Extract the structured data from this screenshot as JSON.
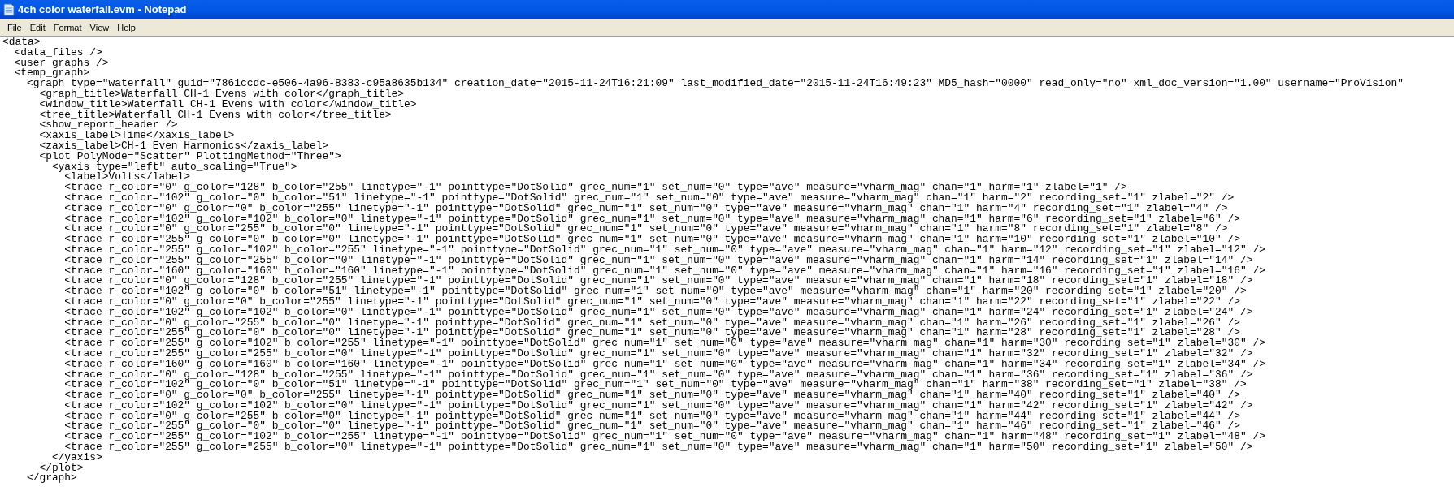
{
  "window": {
    "title": "4ch color waterfall.evm - Notepad"
  },
  "menu": [
    "File",
    "Edit",
    "Format",
    "View",
    "Help"
  ],
  "editor": {
    "lines": [
      "<data>",
      "  <data_files />",
      "  <user_graphs />",
      "  <temp_graph>",
      "    <graph type=\"waterfall\" guid=\"7861ccdc-e506-4a96-8383-c95a8635b134\" creation_date=\"2015-11-24T16:21:09\" last_modified_date=\"2015-11-24T16:49:23\" MD5_hash=\"0000\" read_only=\"no\" xml_doc_version=\"1.00\" username=\"ProVision\"",
      "      <graph_title>Waterfall CH-1 Evens with color</graph_title>",
      "      <window_title>Waterfall CH-1 Evens with color</window_title>",
      "      <tree_title>Waterfall CH-1 Evens with color</tree_title>",
      "      <show_report_header />",
      "      <xaxis_label>Time</xaxis_label>",
      "      <zaxis_label>CH-1 Even Harmonics</zaxis_label>",
      "      <plot PolyMode=\"Scatter\" PlottingMethod=\"Three\">",
      "        <yaxis type=\"left\" auto_scaling=\"True\">",
      "          <label>Volts</label>",
      "          <trace r_color=\"0\" g_color=\"128\" b_color=\"255\" linetype=\"-1\" pointtype=\"DotSolid\" grec_num=\"1\" set_num=\"0\" type=\"ave\" measure=\"vharm_mag\" chan=\"1\" harm=\"1\" zlabel=\"1\" />",
      "          <trace r_color=\"102\" g_color=\"0\" b_color=\"51\" linetype=\"-1\" pointtype=\"DotSolid\" grec_num=\"1\" set_num=\"0\" type=\"ave\" measure=\"vharm_mag\" chan=\"1\" harm=\"2\" recording_set=\"1\" zlabel=\"2\" />",
      "          <trace r_color=\"0\" g_color=\"0\" b_color=\"255\" linetype=\"-1\" pointtype=\"DotSolid\" grec_num=\"1\" set_num=\"0\" type=\"ave\" measure=\"vharm_mag\" chan=\"1\" harm=\"4\" recording_set=\"1\" zlabel=\"4\" />",
      "          <trace r_color=\"102\" g_color=\"102\" b_color=\"0\" linetype=\"-1\" pointtype=\"DotSolid\" grec_num=\"1\" set_num=\"0\" type=\"ave\" measure=\"vharm_mag\" chan=\"1\" harm=\"6\" recording_set=\"1\" zlabel=\"6\" />",
      "          <trace r_color=\"0\" g_color=\"255\" b_color=\"0\" linetype=\"-1\" pointtype=\"DotSolid\" grec_num=\"1\" set_num=\"0\" type=\"ave\" measure=\"vharm_mag\" chan=\"1\" harm=\"8\" recording_set=\"1\" zlabel=\"8\" />",
      "          <trace r_color=\"255\" g_color=\"0\" b_color=\"0\" linetype=\"-1\" pointtype=\"DotSolid\" grec_num=\"1\" set_num=\"0\" type=\"ave\" measure=\"vharm_mag\" chan=\"1\" harm=\"10\" recording_set=\"1\" zlabel=\"10\" />",
      "          <trace r_color=\"255\" g_color=\"102\" b_color=\"255\" linetype=\"-1\" pointtype=\"DotSolid\" grec_num=\"1\" set_num=\"0\" type=\"ave\" measure=\"vharm_mag\" chan=\"1\" harm=\"12\" recording_set=\"1\" zlabel=\"12\" />",
      "          <trace r_color=\"255\" g_color=\"255\" b_color=\"0\" linetype=\"-1\" pointtype=\"DotSolid\" grec_num=\"1\" set_num=\"0\" type=\"ave\" measure=\"vharm_mag\" chan=\"1\" harm=\"14\" recording_set=\"1\" zlabel=\"14\" />",
      "          <trace r_color=\"160\" g_color=\"160\" b_color=\"160\" linetype=\"-1\" pointtype=\"DotSolid\" grec_num=\"1\" set_num=\"0\" type=\"ave\" measure=\"vharm_mag\" chan=\"1\" harm=\"16\" recording_set=\"1\" zlabel=\"16\" />",
      "          <trace r_color=\"0\" g_color=\"128\" b_color=\"255\" linetype=\"-1\" pointtype=\"DotSolid\" grec_num=\"1\" set_num=\"0\" type=\"ave\" measure=\"vharm_mag\" chan=\"1\" harm=\"18\" recording_set=\"1\" zlabel=\"18\" />",
      "          <trace r_color=\"102\" g_color=\"0\" b_color=\"51\" linetype=\"-1\" pointtype=\"DotSolid\" grec_num=\"1\" set_num=\"0\" type=\"ave\" measure=\"vharm_mag\" chan=\"1\" harm=\"20\" recording_set=\"1\" zlabel=\"20\" />",
      "          <trace r_color=\"0\" g_color=\"0\" b_color=\"255\" linetype=\"-1\" pointtype=\"DotSolid\" grec_num=\"1\" set_num=\"0\" type=\"ave\" measure=\"vharm_mag\" chan=\"1\" harm=\"22\" recording_set=\"1\" zlabel=\"22\" />",
      "          <trace r_color=\"102\" g_color=\"102\" b_color=\"0\" linetype=\"-1\" pointtype=\"DotSolid\" grec_num=\"1\" set_num=\"0\" type=\"ave\" measure=\"vharm_mag\" chan=\"1\" harm=\"24\" recording_set=\"1\" zlabel=\"24\" />",
      "          <trace r_color=\"0\" g_color=\"255\" b_color=\"0\" linetype=\"-1\" pointtype=\"DotSolid\" grec_num=\"1\" set_num=\"0\" type=\"ave\" measure=\"vharm_mag\" chan=\"1\" harm=\"26\" recording_set=\"1\" zlabel=\"26\" />",
      "          <trace r_color=\"255\" g_color=\"0\" b_color=\"0\" linetype=\"-1\" pointtype=\"DotSolid\" grec_num=\"1\" set_num=\"0\" type=\"ave\" measure=\"vharm_mag\" chan=\"1\" harm=\"28\" recording_set=\"1\" zlabel=\"28\" />",
      "          <trace r_color=\"255\" g_color=\"102\" b_color=\"255\" linetype=\"-1\" pointtype=\"DotSolid\" grec_num=\"1\" set_num=\"0\" type=\"ave\" measure=\"vharm_mag\" chan=\"1\" harm=\"30\" recording_set=\"1\" zlabel=\"30\" />",
      "          <trace r_color=\"255\" g_color=\"255\" b_color=\"0\" linetype=\"-1\" pointtype=\"DotSolid\" grec_num=\"1\" set_num=\"0\" type=\"ave\" measure=\"vharm_mag\" chan=\"1\" harm=\"32\" recording_set=\"1\" zlabel=\"32\" />",
      "          <trace r_color=\"160\" g_color=\"160\" b_color=\"160\" linetype=\"-1\" pointtype=\"DotSolid\" grec_num=\"1\" set_num=\"0\" type=\"ave\" measure=\"vharm_mag\" chan=\"1\" harm=\"34\" recording_set=\"1\" zlabel=\"34\" />",
      "          <trace r_color=\"0\" g_color=\"128\" b_color=\"255\" linetype=\"-1\" pointtype=\"DotSolid\" grec_num=\"1\" set_num=\"0\" type=\"ave\" measure=\"vharm_mag\" chan=\"1\" harm=\"36\" recording_set=\"1\" zlabel=\"36\" />",
      "          <trace r_color=\"102\" g_color=\"0\" b_color=\"51\" linetype=\"-1\" pointtype=\"DotSolid\" grec_num=\"1\" set_num=\"0\" type=\"ave\" measure=\"vharm_mag\" chan=\"1\" harm=\"38\" recording_set=\"1\" zlabel=\"38\" />",
      "          <trace r_color=\"0\" g_color=\"0\" b_color=\"255\" linetype=\"-1\" pointtype=\"DotSolid\" grec_num=\"1\" set_num=\"0\" type=\"ave\" measure=\"vharm_mag\" chan=\"1\" harm=\"40\" recording_set=\"1\" zlabel=\"40\" />",
      "          <trace r_color=\"102\" g_color=\"102\" b_color=\"0\" linetype=\"-1\" pointtype=\"DotSolid\" grec_num=\"1\" set_num=\"0\" type=\"ave\" measure=\"vharm_mag\" chan=\"1\" harm=\"42\" recording_set=\"1\" zlabel=\"42\" />",
      "          <trace r_color=\"0\" g_color=\"255\" b_color=\"0\" linetype=\"-1\" pointtype=\"DotSolid\" grec_num=\"1\" set_num=\"0\" type=\"ave\" measure=\"vharm_mag\" chan=\"1\" harm=\"44\" recording_set=\"1\" zlabel=\"44\" />",
      "          <trace r_color=\"255\" g_color=\"0\" b_color=\"0\" linetype=\"-1\" pointtype=\"DotSolid\" grec_num=\"1\" set_num=\"0\" type=\"ave\" measure=\"vharm_mag\" chan=\"1\" harm=\"46\" recording_set=\"1\" zlabel=\"46\" />",
      "          <trace r_color=\"255\" g_color=\"102\" b_color=\"255\" linetype=\"-1\" pointtype=\"DotSolid\" grec_num=\"1\" set_num=\"0\" type=\"ave\" measure=\"vharm_mag\" chan=\"1\" harm=\"48\" recording_set=\"1\" zlabel=\"48\" />",
      "          <trace r_color=\"255\" g_color=\"255\" b_color=\"0\" linetype=\"-1\" pointtype=\"DotSolid\" grec_num=\"1\" set_num=\"0\" type=\"ave\" measure=\"vharm_mag\" chan=\"1\" harm=\"50\" recording_set=\"1\" zlabel=\"50\" />",
      "        </yaxis>",
      "      </plot>",
      "    </graph>"
    ]
  }
}
